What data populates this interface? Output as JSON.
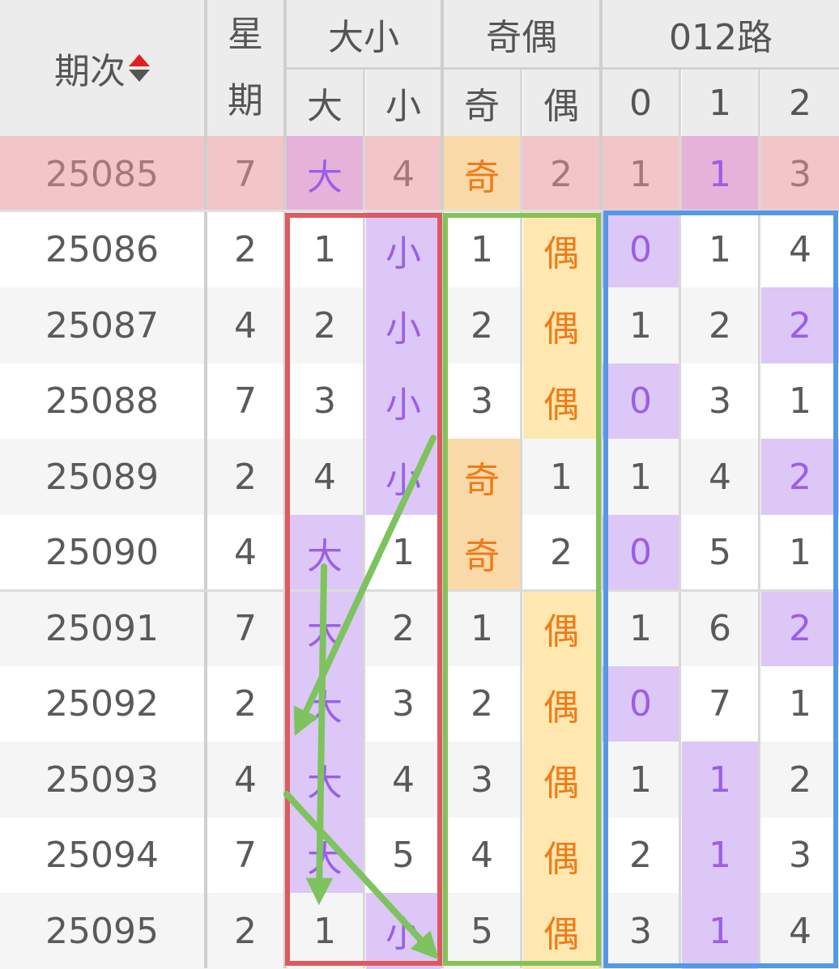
{
  "header": {
    "period_label": "期次",
    "week_label_top": "星",
    "week_label_bottom": "期",
    "groups": [
      "大小",
      "奇偶",
      "012路"
    ],
    "subs": [
      "大",
      "小",
      "奇",
      "偶",
      "0",
      "1",
      "2"
    ]
  },
  "colors": {
    "hl_row": "#f2c6c8",
    "purple": "#dcc7f7",
    "pink_purple": "#e6b2d9",
    "orange": "#fad9a8",
    "yellow": "#fee8b0",
    "text_purple": "#9b5ee8",
    "text_orange": "#f07a18",
    "text_gray": "#5a5a5a",
    "text_hl": "#a5787a",
    "box_red": "#dc5a60",
    "box_green": "#84c259",
    "box_blue": "#5598e6",
    "arrow_green": "#7dc35e"
  },
  "rows": [
    {
      "period": "25085",
      "week": "7",
      "cells": [
        "大",
        "4",
        "奇",
        "2",
        "1",
        "1",
        "3"
      ],
      "hl": [
        0,
        2,
        5
      ],
      "highlight_row": true
    },
    {
      "period": "25086",
      "week": "2",
      "cells": [
        "1",
        "小",
        "1",
        "偶",
        "0",
        "1",
        "4"
      ],
      "hl": [
        1,
        3,
        4
      ]
    },
    {
      "period": "25087",
      "week": "4",
      "cells": [
        "2",
        "小",
        "2",
        "偶",
        "1",
        "2",
        "2"
      ],
      "hl": [
        1,
        3,
        6
      ]
    },
    {
      "period": "25088",
      "week": "7",
      "cells": [
        "3",
        "小",
        "3",
        "偶",
        "0",
        "3",
        "1"
      ],
      "hl": [
        1,
        3,
        4
      ]
    },
    {
      "period": "25089",
      "week": "2",
      "cells": [
        "4",
        "小",
        "奇",
        "1",
        "1",
        "4",
        "2"
      ],
      "hl": [
        1,
        2,
        6
      ]
    },
    {
      "period": "25090",
      "week": "4",
      "cells": [
        "大",
        "1",
        "奇",
        "2",
        "0",
        "5",
        "1"
      ],
      "hl": [
        0,
        2,
        4
      ]
    },
    {
      "period": "25091",
      "week": "7",
      "cells": [
        "大",
        "2",
        "1",
        "偶",
        "1",
        "6",
        "2"
      ],
      "hl": [
        0,
        3,
        6
      ]
    },
    {
      "period": "25092",
      "week": "2",
      "cells": [
        "大",
        "3",
        "2",
        "偶",
        "0",
        "7",
        "1"
      ],
      "hl": [
        0,
        3,
        4
      ]
    },
    {
      "period": "25093",
      "week": "4",
      "cells": [
        "大",
        "4",
        "3",
        "偶",
        "1",
        "1",
        "2"
      ],
      "hl": [
        0,
        3,
        5
      ]
    },
    {
      "period": "25094",
      "week": "7",
      "cells": [
        "大",
        "5",
        "4",
        "偶",
        "2",
        "1",
        "3"
      ],
      "hl": [
        0,
        3,
        5
      ]
    },
    {
      "period": "25095",
      "week": "2",
      "cells": [
        "1",
        "小",
        "5",
        "偶",
        "3",
        "1",
        "4"
      ],
      "hl": [
        1,
        3,
        5
      ]
    }
  ]
}
